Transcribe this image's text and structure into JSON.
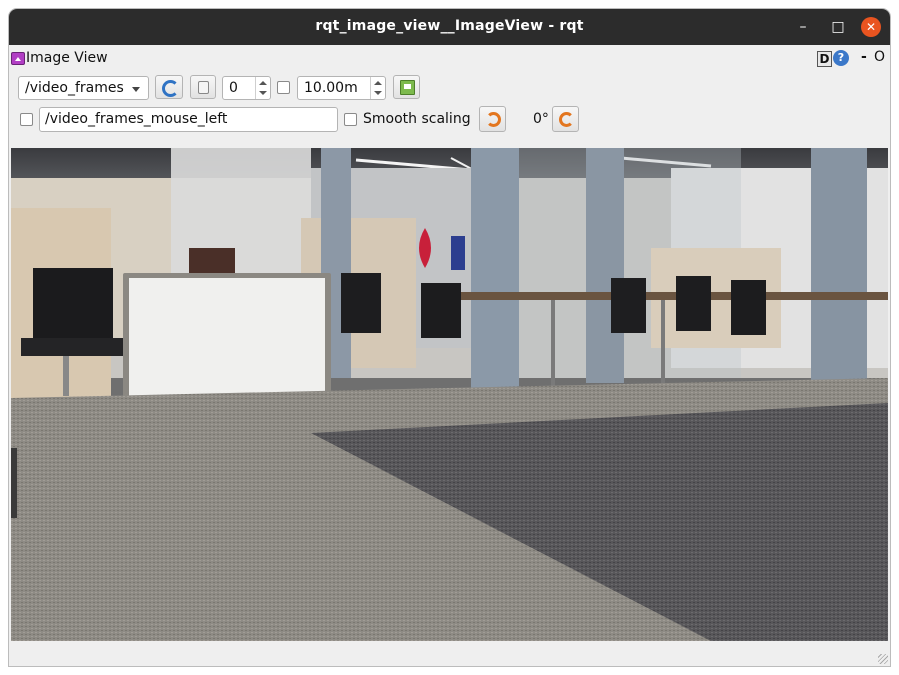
{
  "window": {
    "title": "rqt_image_view__ImageView - rqt",
    "minimize_glyph": "–",
    "maximize_glyph": "□",
    "close_glyph": "✕"
  },
  "dock": {
    "title": "Image View",
    "plugin_icon": "image-view-plugin-icon",
    "d_label": "D",
    "help_label": "?",
    "minimize_label": "-",
    "close_label": "O"
  },
  "toolbar": {
    "topic": "/video_frames",
    "frame_index": "0",
    "duration": "10.00m",
    "mouse_topic": "/video_frames_mouse_left",
    "smooth_label": "Smooth scaling",
    "rotation": "0°",
    "icons": {
      "refresh": "refresh-icon",
      "pause": "pause-icon",
      "save": "save-image-icon",
      "rotate_left": "rotate-left-icon",
      "rotate_right": "rotate-right-icon"
    }
  },
  "image": {
    "description_icon": "camera-frame-office"
  },
  "colors": {
    "titlebar": "#2c2c2c",
    "close": "#e95420",
    "accent_blue": "#2f73c4",
    "accent_orange": "#e3761f"
  }
}
